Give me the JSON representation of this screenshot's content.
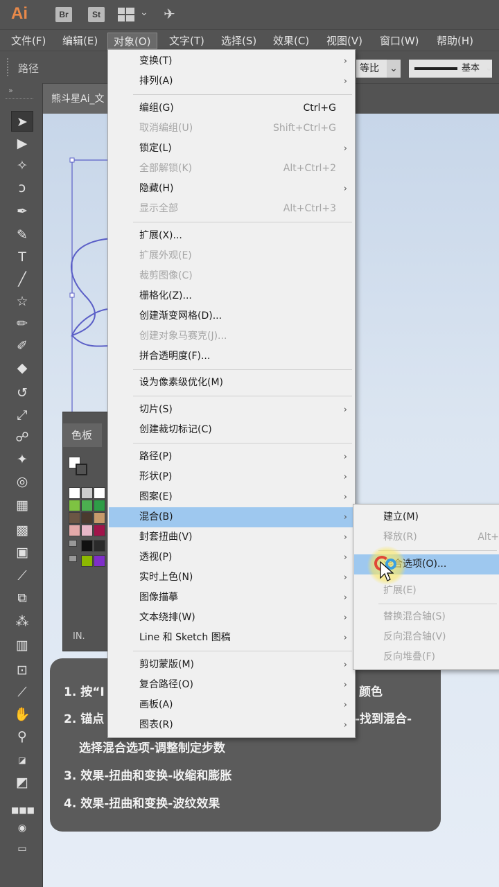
{
  "app": {
    "logo": "Ai",
    "bridge": "Br",
    "stock": "St"
  },
  "menubar": [
    {
      "label": "文件(F)"
    },
    {
      "label": "编辑(E)"
    },
    {
      "label": "对象(O)"
    },
    {
      "label": "文字(T)"
    },
    {
      "label": "选择(S)"
    },
    {
      "label": "效果(C)"
    },
    {
      "label": "视图(V)"
    },
    {
      "label": "窗口(W)"
    },
    {
      "label": "帮助(H)"
    }
  ],
  "control_bar": {
    "path_label": "路径",
    "ratio_value": "等比",
    "stroke_profile": "基本"
  },
  "document_tab": "熊斗星Ai_文",
  "object_menu": {
    "items": [
      {
        "label": "变换(T)",
        "shortcut": "",
        "submenu": true,
        "disabled": false
      },
      {
        "label": "排列(A)",
        "shortcut": "",
        "submenu": true,
        "disabled": false
      },
      {
        "label": "编组(G)",
        "shortcut": "Ctrl+G",
        "submenu": false,
        "disabled": false
      },
      {
        "label": "取消编组(U)",
        "shortcut": "Shift+Ctrl+G",
        "submenu": false,
        "disabled": true
      },
      {
        "label": "锁定(L)",
        "shortcut": "",
        "submenu": true,
        "disabled": false
      },
      {
        "label": "全部解锁(K)",
        "shortcut": "Alt+Ctrl+2",
        "submenu": false,
        "disabled": true
      },
      {
        "label": "隐藏(H)",
        "shortcut": "",
        "submenu": true,
        "disabled": false
      },
      {
        "label": "显示全部",
        "shortcut": "Alt+Ctrl+3",
        "submenu": false,
        "disabled": true
      },
      {
        "label": "扩展(X)...",
        "shortcut": "",
        "submenu": false,
        "disabled": false
      },
      {
        "label": "扩展外观(E)",
        "shortcut": "",
        "submenu": false,
        "disabled": true
      },
      {
        "label": "裁剪图像(C)",
        "shortcut": "",
        "submenu": false,
        "disabled": true
      },
      {
        "label": "栅格化(Z)...",
        "shortcut": "",
        "submenu": false,
        "disabled": false
      },
      {
        "label": "创建渐变网格(D)...",
        "shortcut": "",
        "submenu": false,
        "disabled": false
      },
      {
        "label": "创建对象马赛克(J)...",
        "shortcut": "",
        "submenu": false,
        "disabled": true
      },
      {
        "label": "拼合透明度(F)...",
        "shortcut": "",
        "submenu": false,
        "disabled": false
      },
      {
        "label": "设为像素级优化(M)",
        "shortcut": "",
        "submenu": false,
        "disabled": false
      },
      {
        "label": "切片(S)",
        "shortcut": "",
        "submenu": true,
        "disabled": false
      },
      {
        "label": "创建裁切标记(C)",
        "shortcut": "",
        "submenu": false,
        "disabled": false
      },
      {
        "label": "路径(P)",
        "shortcut": "",
        "submenu": true,
        "disabled": false
      },
      {
        "label": "形状(P)",
        "shortcut": "",
        "submenu": true,
        "disabled": false
      },
      {
        "label": "图案(E)",
        "shortcut": "",
        "submenu": true,
        "disabled": false
      },
      {
        "label": "混合(B)",
        "shortcut": "",
        "submenu": true,
        "disabled": false,
        "highlighted": true
      },
      {
        "label": "封套扭曲(V)",
        "shortcut": "",
        "submenu": true,
        "disabled": false
      },
      {
        "label": "透视(P)",
        "shortcut": "",
        "submenu": true,
        "disabled": false
      },
      {
        "label": "实时上色(N)",
        "shortcut": "",
        "submenu": true,
        "disabled": false
      },
      {
        "label": "图像描摹",
        "shortcut": "",
        "submenu": true,
        "disabled": false
      },
      {
        "label": "文本绕排(W)",
        "shortcut": "",
        "submenu": true,
        "disabled": false
      },
      {
        "label": "Line 和 Sketch 图稿",
        "shortcut": "",
        "submenu": true,
        "disabled": false
      },
      {
        "label": "剪切蒙版(M)",
        "shortcut": "",
        "submenu": true,
        "disabled": false
      },
      {
        "label": "复合路径(O)",
        "shortcut": "",
        "submenu": true,
        "disabled": false
      },
      {
        "label": "画板(A)",
        "shortcut": "",
        "submenu": true,
        "disabled": false
      },
      {
        "label": "图表(R)",
        "shortcut": "",
        "submenu": true,
        "disabled": false
      }
    ]
  },
  "blend_submenu": {
    "items": [
      {
        "label": "建立(M)",
        "shortcut": "",
        "disabled": false
      },
      {
        "label": "释放(R)",
        "shortcut": "Alt+",
        "disabled": true
      },
      {
        "label": "混合选项(O)...",
        "shortcut": "",
        "disabled": false,
        "highlighted": true
      },
      {
        "label": "扩展(E)",
        "shortcut": "",
        "disabled": true
      },
      {
        "label": "替换混合轴(S)",
        "shortcut": "",
        "disabled": true
      },
      {
        "label": "反向混合轴(V)",
        "shortcut": "",
        "disabled": true
      },
      {
        "label": "反向堆叠(F)",
        "shortcut": "",
        "disabled": true
      }
    ]
  },
  "swatches_panel": {
    "tab": "色板",
    "footer": "IN."
  },
  "instructions": {
    "line1": "1. 按“I",
    "line1_tail": "颜色",
    "line2": "2. 锚点",
    "line2_tail": "-找到混合-",
    "line2b": "选择混合选项-调整制定步数",
    "line3": "3. 效果-扭曲和变换-收缩和膨胀",
    "line4": "4. 效果-扭曲和变换-波纹效果"
  },
  "colors": {
    "chrome": "#535353",
    "menu_bg": "#f0f0f0",
    "menu_highlight": "#9ec8ef",
    "path_stroke": "#5b5fc7",
    "logo": "#e8894a"
  }
}
